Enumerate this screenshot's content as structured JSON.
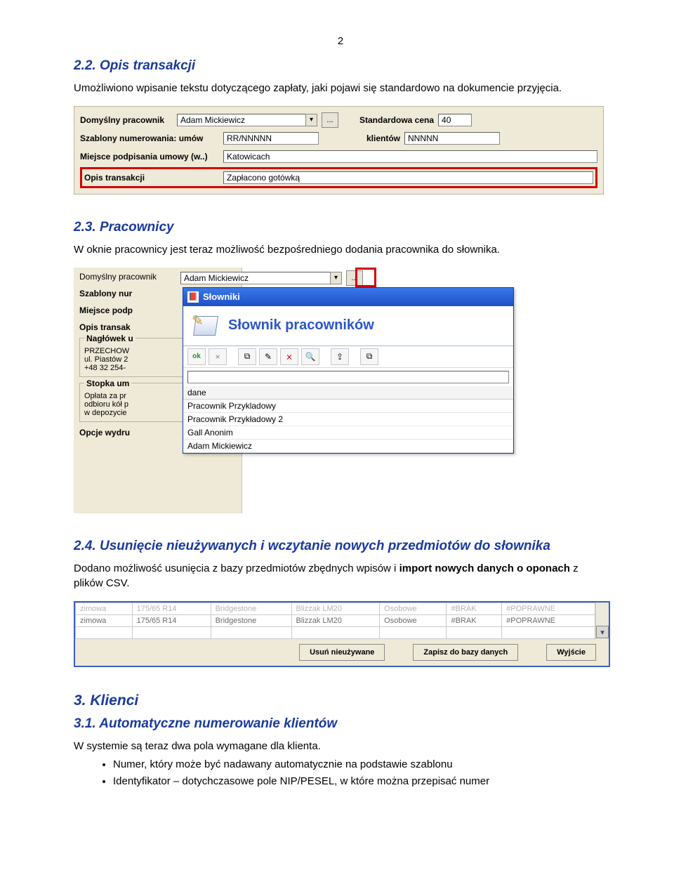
{
  "page_number": "2",
  "sec22": {
    "heading": "2.2. Opis transakcji",
    "body": "Umożliwiono wpisanie tekstu dotyczącego zapłaty, jaki pojawi się standardowo na dokumencie przyjęcia."
  },
  "form1": {
    "lbl_pracownik": "Domyślny pracownik",
    "val_pracownik": "Adam Mickiewicz",
    "btn_more": "...",
    "lbl_cena": "Standardowa cena",
    "val_cena": "40",
    "lbl_szablony": "Szablony numerowania:  umów",
    "val_umow": "RR/NNNNN",
    "lbl_klientow": "klientów",
    "val_klientow": "NNNNN",
    "lbl_miejsce": "Miejsce podpisania umowy (w..)",
    "val_miejsce": "Katowicach",
    "lbl_opis": "Opis transakcji",
    "val_opis": "Zapłacono gotówką"
  },
  "sec23": {
    "heading": "2.3. Pracownicy",
    "body": "W oknie pracownicy jest teraz możliwość bezpośredniego dodania pracownika do słownika."
  },
  "form2": {
    "lbl_pracownik": "Domyślny pracownik",
    "val_pracownik": "Adam Mickiewicz",
    "btn_more": "...",
    "lbl_szablony": "Szablony nur",
    "lbl_miejsce": "Miejsce podp",
    "lbl_opis": "Opis transak",
    "grp_naglowek": "Nagłówek u",
    "naglowek_lines": [
      "PRZECHOW",
      "ul. Piastów 2",
      "+48 32 254-"
    ],
    "grp_stopka": "Stopka um",
    "stopka_lines": [
      "Opłata za pr",
      "odbioru kół p",
      "w depozycie"
    ],
    "lbl_opcje": "Opcje wydru"
  },
  "dialog": {
    "window_title": "Słowniki",
    "header_title": "Słownik pracowników",
    "toolbar": {
      "ok": "ok",
      "close": "×",
      "copy": "⧉",
      "edit": "✎",
      "delete": "⨯",
      "find": "🔍",
      "export": "⇪",
      "new": "⧉"
    },
    "col_header": "dane",
    "rows": [
      "Pracownik Przykladowy",
      "Pracownik Przykładowy 2",
      "Gall Anonim",
      "Adam Mickiewicz"
    ]
  },
  "sec24": {
    "heading": "2.4. Usunięcie nieużywanych i wczytanie nowych przedmiotów do słownika",
    "body_pre": "Dodano możliwość usunięcia z bazy przedmiotów zbędnych wpisów i ",
    "body_bold": "import nowych danych o oponach",
    "body_post": " z plików CSV."
  },
  "grid3": {
    "rows": [
      [
        "zimowa",
        "175/65 R14",
        "Bridgestone",
        "Blizzak LM20",
        "Osobowe",
        "#BRAK",
        "#POPRAWNE"
      ],
      [
        "zimowa",
        "175/65 R14",
        "Bridgestone",
        "Blizzak LM20",
        "Osobowe",
        "#BRAK",
        "#POPRAWNE"
      ]
    ],
    "btn_delete": "Usuń nieużywane",
    "btn_save": "Zapisz do bazy danych",
    "btn_exit": "Wyjście"
  },
  "sec3": {
    "heading": "3. Klienci"
  },
  "sec31": {
    "heading": "3.1. Automatyczne numerowanie klientów",
    "body": "W systemie są teraz dwa pola wymagane dla klienta.",
    "bullets": [
      "Numer, który może być nadawany automatycznie na podstawie szablonu",
      "Identyfikator – dotychczasowe pole NIP/PESEL, w które można przepisać numer"
    ]
  }
}
